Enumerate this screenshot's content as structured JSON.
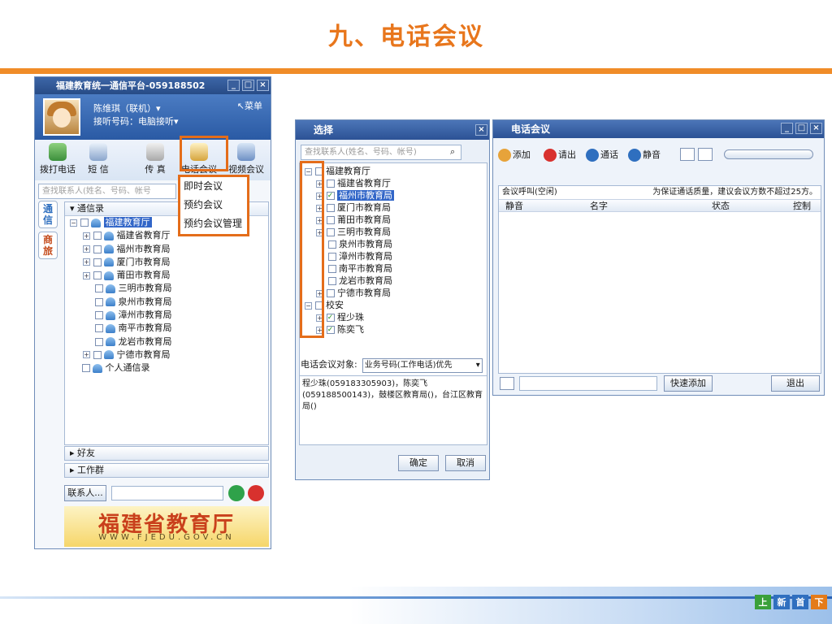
{
  "slide": {
    "title": "九、电话会议",
    "badges": [
      "上",
      "新",
      "首",
      "下"
    ],
    "badge_colors": [
      "#3aa03a",
      "#2f6fbf",
      "#2f6fbf",
      "#e47b1a"
    ]
  },
  "client": {
    "window_title": "福建教育统一通信平台-059188502",
    "menu": "菜单",
    "user": "陈维琪（联机）▾",
    "answer": "接听号码：电脑接听▾",
    "tools": [
      "拨打电话",
      "短 信",
      "传 真",
      "电话会议",
      "视频会议"
    ],
    "search_placeholder": "查找联系人(姓名、号码、帐号",
    "side_tabs": [
      "通信",
      "商旅"
    ],
    "tree_header": "▾ 通信录",
    "tree": [
      {
        "label": "福建教育厅",
        "level": 0,
        "expand": "⊟",
        "selected": true
      },
      {
        "label": "福建省教育厅",
        "level": 1,
        "expand": "+"
      },
      {
        "label": "福州市教育局",
        "level": 1,
        "expand": "+"
      },
      {
        "label": "厦门市教育局",
        "level": 1,
        "expand": "+"
      },
      {
        "label": "莆田市教育局",
        "level": 1,
        "expand": "+"
      },
      {
        "label": "三明市教育局",
        "level": 1,
        "expand": ""
      },
      {
        "label": "泉州市教育局",
        "level": 1,
        "expand": ""
      },
      {
        "label": "漳州市教育局",
        "level": 1,
        "expand": ""
      },
      {
        "label": "南平市教育局",
        "level": 1,
        "expand": ""
      },
      {
        "label": "龙岩市教育局",
        "level": 1,
        "expand": ""
      },
      {
        "label": "宁德市教育局",
        "level": 1,
        "expand": "+"
      },
      {
        "label": "个人通信录",
        "level": 0,
        "expand": ""
      }
    ],
    "groups": [
      "▸ 好友",
      "▸ 工作群"
    ],
    "contact_btn": "联系人...",
    "banner_title": "福建省教育厅",
    "banner_url": "WWW.FJEDU.GOV.CN",
    "context_menu": [
      "即时会议",
      "预约会议",
      "预约会议管理"
    ]
  },
  "select_dialog": {
    "title": "选择",
    "search_placeholder": "查找联系人(姓名、号码、帐号)",
    "tree": [
      {
        "label": "福建教育厅",
        "indent": 0,
        "expand": "⊟",
        "checked": false
      },
      {
        "label": "福建省教育厅",
        "indent": 1,
        "expand": "+",
        "checked": false
      },
      {
        "label": "福州市教育局",
        "indent": 1,
        "expand": "+",
        "checked": true,
        "selected": true
      },
      {
        "label": "厦门市教育局",
        "indent": 1,
        "expand": "+",
        "checked": false
      },
      {
        "label": "莆田市教育局",
        "indent": 1,
        "expand": "+",
        "checked": false
      },
      {
        "label": "三明市教育局",
        "indent": 1,
        "expand": "+",
        "checked": false
      },
      {
        "label": "泉州市教育局",
        "indent": 1,
        "expand": "",
        "checked": false
      },
      {
        "label": "漳州市教育局",
        "indent": 1,
        "expand": "",
        "checked": false
      },
      {
        "label": "南平市教育局",
        "indent": 1,
        "expand": "",
        "checked": false
      },
      {
        "label": "龙岩市教育局",
        "indent": 1,
        "expand": "",
        "checked": false
      },
      {
        "label": "宁德市教育局",
        "indent": 1,
        "expand": "+",
        "checked": false
      },
      {
        "label": "校安",
        "indent": 0,
        "expand": "⊟",
        "checked": false
      },
      {
        "label": "程少珠",
        "indent": 1,
        "expand": "+",
        "checked": true
      },
      {
        "label": "陈奕飞",
        "indent": 1,
        "expand": "+",
        "checked": true
      }
    ],
    "object_label": "电话会议对象:",
    "object_value": "业务号码(工作电话)优先",
    "members_text": "程少珠(059183305903)，陈奕飞(059188500143)，鼓楼区教育局()，台江区教育局()",
    "ok": "确定",
    "cancel": "取消"
  },
  "conference": {
    "title": "电话会议",
    "actions": [
      "添加",
      "请出",
      "通话",
      "静音"
    ],
    "status_left": "会议呼叫(空闲)",
    "status_right": "为保证通话质量，建议会议方数不超过25方。",
    "columns": [
      "静音",
      "名字",
      "状态",
      "控制"
    ],
    "quick_add": "快速添加",
    "exit": "退出"
  }
}
